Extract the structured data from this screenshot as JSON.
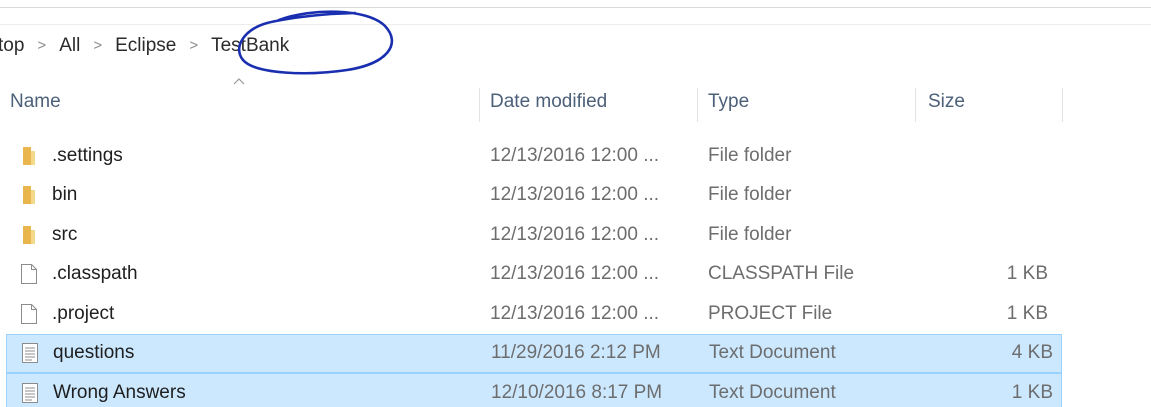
{
  "breadcrumb": {
    "items": [
      "top",
      "All",
      "Eclipse",
      "TestBank"
    ],
    "separator": ">"
  },
  "columns": {
    "name": "Name",
    "date": "Date modified",
    "type": "Type",
    "size": "Size"
  },
  "files": [
    {
      "name": ".settings",
      "date": "12/13/2016 12:00 ...",
      "type": "File folder",
      "size": "",
      "icon": "folder-icon",
      "selected": false
    },
    {
      "name": "bin",
      "date": "12/13/2016 12:00 ...",
      "type": "File folder",
      "size": "",
      "icon": "folder-icon",
      "selected": false
    },
    {
      "name": "src",
      "date": "12/13/2016 12:00 ...",
      "type": "File folder",
      "size": "",
      "icon": "folder-icon",
      "selected": false
    },
    {
      "name": ".classpath",
      "date": "12/13/2016 12:00 ...",
      "type": "CLASSPATH File",
      "size": "1 KB",
      "icon": "blank-file-icon",
      "selected": false
    },
    {
      "name": ".project",
      "date": "12/13/2016 12:00 ...",
      "type": "PROJECT File",
      "size": "1 KB",
      "icon": "blank-file-icon",
      "selected": false
    },
    {
      "name": "questions",
      "date": "11/29/2016 2:12 PM",
      "type": "Text Document",
      "size": "4 KB",
      "icon": "text-document-icon",
      "selected": true
    },
    {
      "name": "Wrong Answers",
      "date": "12/10/2016 8:17 PM",
      "type": "Text Document",
      "size": "1 KB",
      "icon": "text-document-icon",
      "selected": true
    }
  ],
  "colors": {
    "folder": "#e8b64c",
    "selection_bg": "#cce8ff",
    "selection_border": "#99d1ff",
    "header_text": "#4c607a",
    "annotation": "#1a2fb0"
  }
}
